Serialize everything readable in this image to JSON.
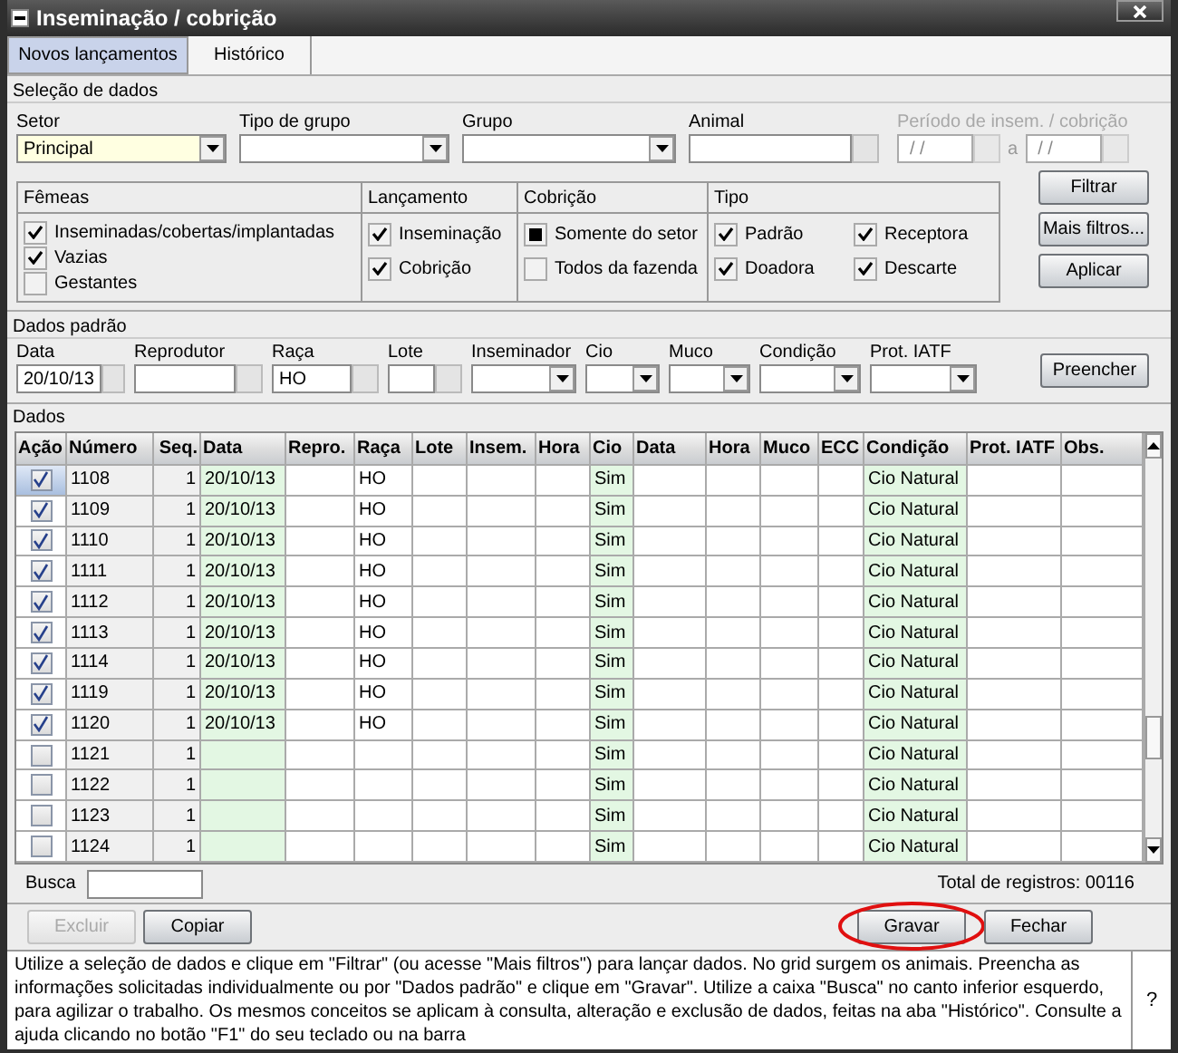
{
  "window": {
    "title": "Inseminação / cobrição"
  },
  "tabs": [
    {
      "label": "Novos lançamentos",
      "selected": true
    },
    {
      "label": "Histórico",
      "selected": false
    }
  ],
  "selection": {
    "title": "Seleção de dados",
    "fields": [
      {
        "label": "Setor",
        "kind": "select",
        "value": "Principal",
        "highlighted": true
      },
      {
        "label": "Tipo de grupo",
        "kind": "select",
        "highlighted": false
      },
      {
        "label": "Grupo",
        "kind": "select",
        "highlighted": false
      },
      {
        "label": "Animal",
        "kind": "lookup",
        "highlighted": false
      }
    ],
    "period": {
      "label": "Período de insem. / cobrição",
      "disabled": true,
      "from": "/ /",
      "separator": "a",
      "to": "/ /"
    },
    "groups": [
      {
        "title": "Fêmeas",
        "options": [
          {
            "label": "Inseminadas/cobertas/implantadas",
            "kind": "checkbox",
            "checked": true
          },
          {
            "label": "Vazias",
            "kind": "checkbox",
            "checked": true
          },
          {
            "label": "Gestantes",
            "kind": "checkbox",
            "checked": false
          }
        ]
      },
      {
        "title": "Lançamento",
        "options": [
          {
            "label": "Inseminação",
            "kind": "checkbox",
            "checked": true
          },
          {
            "label": "Cobrição",
            "kind": "checkbox",
            "checked": true
          }
        ]
      },
      {
        "title": "Cobrição",
        "options": [
          {
            "label": "Somente do setor",
            "kind": "radio",
            "checked": true
          },
          {
            "label": "Todos da fazenda",
            "kind": "radio",
            "checked": false
          }
        ]
      },
      {
        "title": "Tipo",
        "options": [
          {
            "label": "Padrão",
            "kind": "checkbox",
            "checked": true
          },
          {
            "label": "Receptora",
            "kind": "checkbox",
            "checked": true
          },
          {
            "label": "Doadora",
            "kind": "checkbox",
            "checked": true
          },
          {
            "label": "Descarte",
            "kind": "checkbox",
            "checked": true
          }
        ]
      }
    ],
    "buttons": [
      {
        "label": "Filtrar"
      },
      {
        "label": "Mais filtros..."
      },
      {
        "label": "Aplicar"
      }
    ]
  },
  "defaults": {
    "title": "Dados padrão",
    "fields": [
      {
        "label": "Data",
        "kind": "lookup",
        "value": "20/10/13"
      },
      {
        "label": "Reprodutor",
        "kind": "lookup"
      },
      {
        "label": "Raça",
        "kind": "lookup",
        "value": "HO"
      },
      {
        "label": "Lote",
        "kind": "lookup"
      },
      {
        "label": "Inseminador",
        "kind": "select"
      },
      {
        "label": "Cio",
        "kind": "select"
      },
      {
        "label": "Muco",
        "kind": "select"
      },
      {
        "label": "Condição",
        "kind": "select"
      },
      {
        "label": "Prot. IATF",
        "kind": "select"
      }
    ],
    "button": "Preencher"
  },
  "grid": {
    "title": "Dados",
    "columns": [
      "Ação",
      "Número",
      "Seq.",
      "Data",
      "Repro.",
      "Raça",
      "Lote",
      "Insem.",
      "Hora",
      "Cio",
      "Data",
      "Hora",
      "Muco",
      "ECC",
      "Condição",
      "Prot. IATF",
      "Obs."
    ],
    "rows": [
      {
        "checked": true,
        "selected": true,
        "numero": "1108",
        "seq": "1",
        "data": "20/10/13",
        "raca": "HO",
        "cio": "Sim",
        "condicao": "Cio Natural"
      },
      {
        "checked": true,
        "selected": false,
        "numero": "1109",
        "seq": "1",
        "data": "20/10/13",
        "raca": "HO",
        "cio": "Sim",
        "condicao": "Cio Natural"
      },
      {
        "checked": true,
        "selected": false,
        "numero": "1110",
        "seq": "1",
        "data": "20/10/13",
        "raca": "HO",
        "cio": "Sim",
        "condicao": "Cio Natural"
      },
      {
        "checked": true,
        "selected": false,
        "numero": "1111",
        "seq": "1",
        "data": "20/10/13",
        "raca": "HO",
        "cio": "Sim",
        "condicao": "Cio Natural"
      },
      {
        "checked": true,
        "selected": false,
        "numero": "1112",
        "seq": "1",
        "data": "20/10/13",
        "raca": "HO",
        "cio": "Sim",
        "condicao": "Cio Natural"
      },
      {
        "checked": true,
        "selected": false,
        "numero": "1113",
        "seq": "1",
        "data": "20/10/13",
        "raca": "HO",
        "cio": "Sim",
        "condicao": "Cio Natural"
      },
      {
        "checked": true,
        "selected": false,
        "numero": "1114",
        "seq": "1",
        "data": "20/10/13",
        "raca": "HO",
        "cio": "Sim",
        "condicao": "Cio Natural"
      },
      {
        "checked": true,
        "selected": false,
        "numero": "1119",
        "seq": "1",
        "data": "20/10/13",
        "raca": "HO",
        "cio": "Sim",
        "condicao": "Cio Natural"
      },
      {
        "checked": true,
        "selected": false,
        "numero": "1120",
        "seq": "1",
        "data": "20/10/13",
        "raca": "HO",
        "cio": "Sim",
        "condicao": "Cio Natural"
      },
      {
        "checked": false,
        "selected": false,
        "numero": "1121",
        "seq": "1",
        "cio": "Sim",
        "condicao": "Cio Natural"
      },
      {
        "checked": false,
        "selected": false,
        "numero": "1122",
        "seq": "1",
        "cio": "Sim",
        "condicao": "Cio Natural"
      },
      {
        "checked": false,
        "selected": false,
        "numero": "1123",
        "seq": "1",
        "cio": "Sim",
        "condicao": "Cio Natural"
      },
      {
        "checked": false,
        "selected": false,
        "numero": "1124",
        "seq": "1",
        "cio": "Sim",
        "condicao": "Cio Natural"
      }
    ]
  },
  "search": {
    "label": "Busca"
  },
  "total": "Total de registros: 00116",
  "actions": [
    {
      "label": "Excluir",
      "disabled": true,
      "highlighted": false
    },
    {
      "label": "Copiar",
      "disabled": false,
      "highlighted": false
    },
    {
      "label": "Gravar",
      "disabled": false,
      "highlighted": true
    },
    {
      "label": "Fechar",
      "disabled": false,
      "highlighted": false
    }
  ],
  "help": {
    "text": "Utilize a seleção de dados e clique em \"Filtrar\" (ou acesse \"Mais filtros\") para lançar dados. No grid surgem os animais. Preencha as informações solicitadas individualmente ou por \"Dados padrão\" e clique em  \"Gravar\". Utilize a caixa \"Busca\" no canto inferior esquerdo, para agilizar o trabalho. Os mesmos conceitos se aplicam à consulta, alteração e exclusão de dados, feitas na aba \"Histórico\". Consulte a ajuda clicando no botão \"F1\" do seu teclado ou na barra",
    "button": "?"
  }
}
